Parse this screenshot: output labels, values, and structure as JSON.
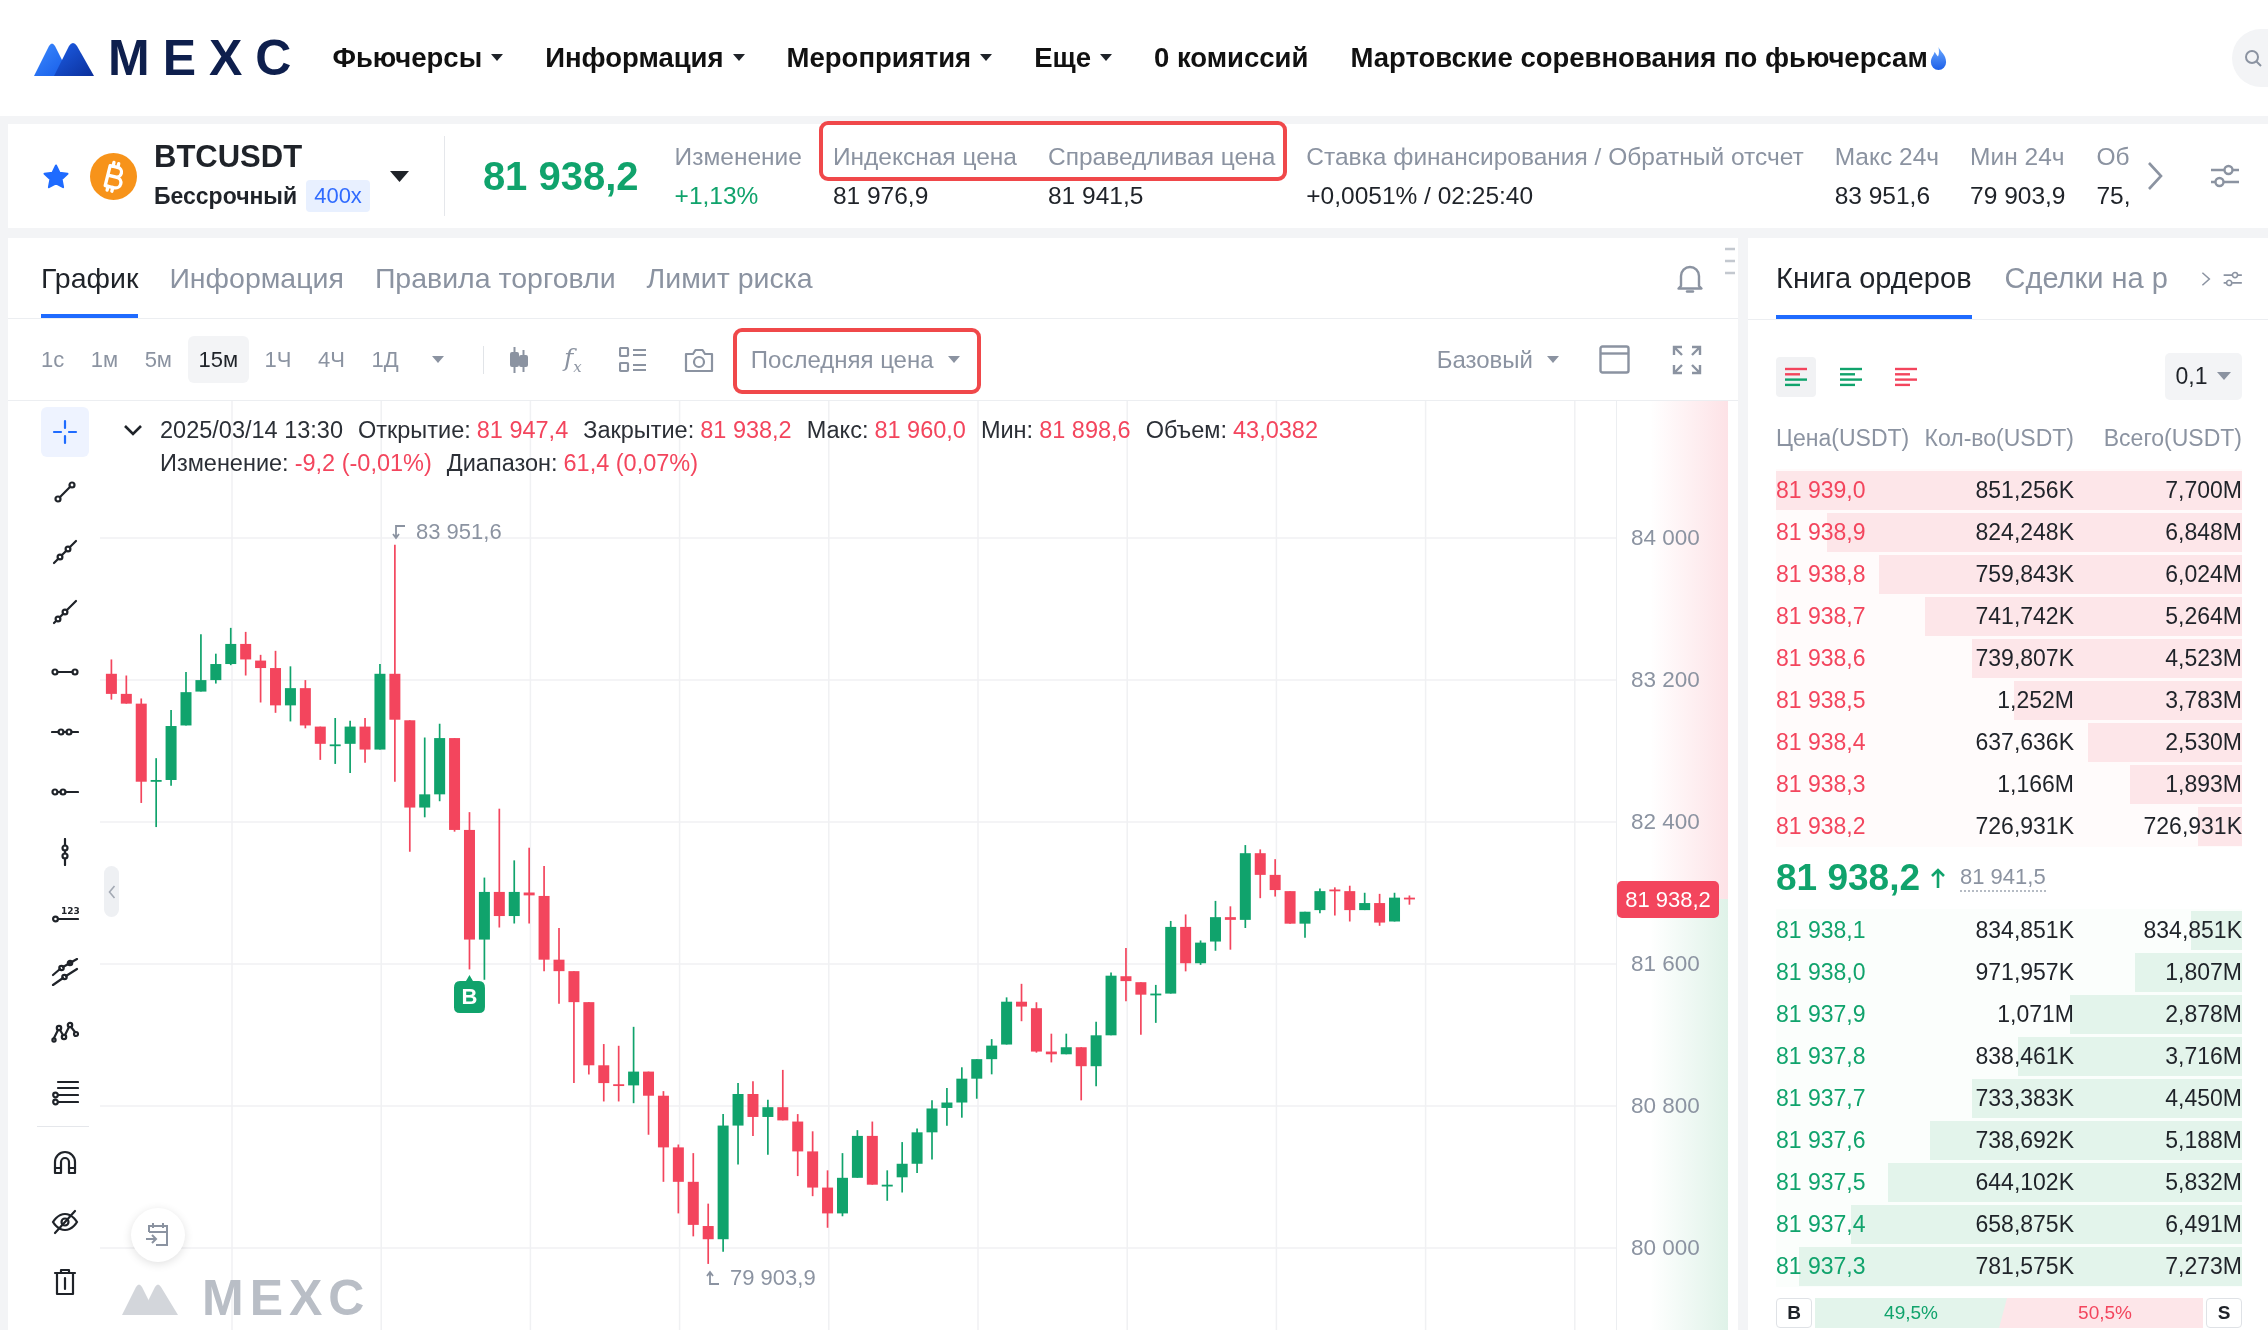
{
  "nav": {
    "logo": "MEXC",
    "items": [
      {
        "label": "Фьючерсы",
        "dropdown": true,
        "hot": false
      },
      {
        "label": "Информация",
        "dropdown": true,
        "hot": false
      },
      {
        "label": "Мероприятия",
        "dropdown": true,
        "hot": false
      },
      {
        "label": "Еще",
        "dropdown": true,
        "hot": false
      },
      {
        "label": "0 комиссий",
        "dropdown": false,
        "hot": false
      },
      {
        "label": "Мартовские соревнования по фьючерсам",
        "dropdown": false,
        "hot": true
      }
    ]
  },
  "ticker": {
    "favorite": true,
    "symbol": "BTCUSDT",
    "contract": "Бессрочный",
    "leverage": "400x",
    "price": "81 938,2",
    "price_up": true,
    "stats": [
      {
        "label": "Изменение",
        "value": "+1,13%",
        "kind": "change",
        "highlighted": false
      },
      {
        "label": "Индексная цена",
        "value": "81 976,9",
        "kind": "plain",
        "highlighted": true
      },
      {
        "label": "Справедливая цена",
        "value": "81 941,5",
        "kind": "plain",
        "highlighted": true
      },
      {
        "label": "Ставка финансирования / Обратный отсчет",
        "value": "+0,0051% / 02:25:40",
        "kind": "plain",
        "highlighted": false
      },
      {
        "label": "Макс 24ч",
        "value": "83 951,6",
        "kind": "plain",
        "highlighted": false
      },
      {
        "label": "Мин 24ч",
        "value": "79 903,9",
        "kind": "plain",
        "highlighted": false
      },
      {
        "label": "Об",
        "value": "75,",
        "kind": "plain",
        "highlighted": false
      }
    ]
  },
  "chart_panel": {
    "tabs": [
      {
        "label": "График",
        "selected": true
      },
      {
        "label": "Информация",
        "selected": false
      },
      {
        "label": "Правила торговли",
        "selected": false
      },
      {
        "label": "Лимит риска",
        "selected": false
      }
    ],
    "intervals": [
      {
        "label": "1с",
        "selected": false
      },
      {
        "label": "1м",
        "selected": false
      },
      {
        "label": "5м",
        "selected": false
      },
      {
        "label": "15м",
        "selected": true
      },
      {
        "label": "1Ч",
        "selected": false
      },
      {
        "label": "4Ч",
        "selected": false
      },
      {
        "label": "1Д",
        "selected": false
      }
    ],
    "indicators_label": "f$_{x}$",
    "price_source": {
      "value": "Последняя цена",
      "highlighted": true
    },
    "chart_style": "Базовый",
    "drawing_tools": [
      {
        "kind": "crosshair",
        "selected": true
      },
      {
        "kind": "segment",
        "selected": false
      },
      {
        "kind": "ray",
        "selected": false
      },
      {
        "kind": "extended",
        "selected": false
      },
      {
        "kind": "hsegment",
        "selected": false
      },
      {
        "kind": "hline",
        "selected": false
      },
      {
        "kind": "hray",
        "selected": false
      },
      {
        "kind": "vline",
        "selected": false
      },
      {
        "kind": "pricelabel",
        "selected": false,
        "text": "123"
      },
      {
        "kind": "channel",
        "selected": false
      },
      {
        "kind": "pattern",
        "selected": false
      },
      {
        "kind": "fibonacci",
        "selected": false
      },
      {
        "kind": "magnet",
        "selected": false
      },
      {
        "kind": "hide",
        "selected": false
      },
      {
        "kind": "delete",
        "selected": false
      }
    ],
    "ohlc": {
      "expanded": true,
      "time": "2025/03/14 13:30",
      "up": false,
      "lines": [
        [
          {
            "label": "Открытие:",
            "value": "81 947,4"
          },
          {
            "label": "Закрытие:",
            "value": "81 938,2"
          },
          {
            "label": "Макс:",
            "value": "81 960,0"
          },
          {
            "label": "Мин:",
            "value": "81 898,6"
          },
          {
            "label": "Объем:",
            "value": "43,0382"
          }
        ],
        [
          {
            "label": "Изменение:",
            "value": "-9,2 (-0,01%)"
          },
          {
            "label": "Диапазон:",
            "value": "61,4 (0,07%)"
          }
        ]
      ]
    },
    "price_axis": [
      "84 000",
      "83 200",
      "82 400",
      "81 600",
      "80 800",
      "80 000"
    ],
    "last_price_tag": {
      "value": "81 938,2",
      "up": false
    },
    "high_label": "83 951,6",
    "low_label": "79 903,9",
    "trade_markers": [
      {
        "label": "B",
        "buy": true
      }
    ],
    "watermark_logo": "MEXC"
  },
  "order_book": {
    "tabs": [
      {
        "label": "Книга ордеров",
        "selected": true
      },
      {
        "label": "Сделки на р",
        "selected": false
      }
    ],
    "views": [
      {
        "kind": "both",
        "selected": true
      },
      {
        "kind": "bids",
        "selected": false
      },
      {
        "kind": "asks",
        "selected": false
      }
    ],
    "precision": "0,1",
    "columns": [
      "Цена(USDT)",
      "Кол-во(USDT)",
      "Всего(USDT)"
    ],
    "asks": [
      {
        "price": "81 939,0",
        "amount": "851,256K",
        "total": "7,700M",
        "level": 1.0
      },
      {
        "price": "81 938,9",
        "amount": "824,248K",
        "total": "6,848M",
        "level": 0.89
      },
      {
        "price": "81 938,8",
        "amount": "759,843K",
        "total": "6,024M",
        "level": 0.78
      },
      {
        "price": "81 938,7",
        "amount": "741,742K",
        "total": "5,264M",
        "level": 0.68
      },
      {
        "price": "81 938,6",
        "amount": "739,807K",
        "total": "4,523M",
        "level": 0.58
      },
      {
        "price": "81 938,5",
        "amount": "1,252M",
        "total": "3,783M",
        "level": 0.49
      },
      {
        "price": "81 938,4",
        "amount": "637,636K",
        "total": "2,530M",
        "level": 0.33
      },
      {
        "price": "81 938,3",
        "amount": "1,166M",
        "total": "1,893M",
        "level": 0.24
      },
      {
        "price": "81 938,2",
        "amount": "726,931K",
        "total": "726,931K",
        "level": 0.095
      }
    ],
    "last_price": {
      "value": "81 938,2",
      "up": true
    },
    "mark_price": "81 941,5",
    "bids": [
      {
        "price": "81 938,1",
        "amount": "834,851K",
        "total": "834,851K",
        "level": 0.11
      },
      {
        "price": "81 938,0",
        "amount": "971,957K",
        "total": "1,807M",
        "level": 0.23
      },
      {
        "price": "81 937,9",
        "amount": "1,071M",
        "total": "2,878M",
        "level": 0.37
      },
      {
        "price": "81 937,8",
        "amount": "838,461K",
        "total": "3,716M",
        "level": 0.48
      },
      {
        "price": "81 937,7",
        "amount": "733,383K",
        "total": "4,450M",
        "level": 0.58
      },
      {
        "price": "81 937,6",
        "amount": "738,692K",
        "total": "5,188M",
        "level": 0.67
      },
      {
        "price": "81 937,5",
        "amount": "644,102K",
        "total": "5,832M",
        "level": 0.76
      },
      {
        "price": "81 937,4",
        "amount": "658,875K",
        "total": "6,491M",
        "level": 0.84
      },
      {
        "price": "81 937,3",
        "amount": "781,575K",
        "total": "7,273M",
        "level": 0.95
      }
    ],
    "ratio": {
      "buy_label": "B",
      "buy": "49,5%",
      "sell": "50,5%",
      "sell_label": "S",
      "level": 0.495
    }
  }
}
